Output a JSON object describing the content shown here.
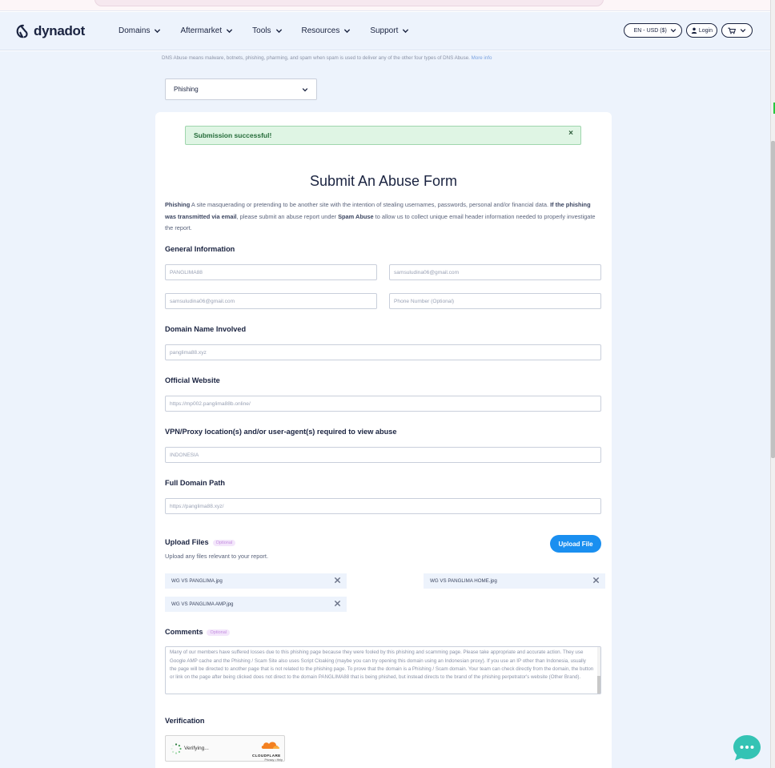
{
  "header": {
    "brand": "dynadot",
    "nav": [
      {
        "label": "Domains"
      },
      {
        "label": "Aftermarket"
      },
      {
        "label": "Tools"
      },
      {
        "label": "Resources"
      },
      {
        "label": "Support"
      }
    ],
    "locale_label": "EN - USD ($)",
    "login_label": "Login"
  },
  "dns_note": {
    "text": "DNS Abuse means malware, botnets, phishing, pharming, and spam when spam is used to deliver any of the other four types of DNS Abuse.",
    "more_link": "More info"
  },
  "abuse_type": {
    "selected": "Phishing"
  },
  "alert": {
    "message": "Submission successful!",
    "close": "×"
  },
  "form": {
    "title": "Submit An Abuse Form",
    "desc": {
      "term": "Phishing",
      "part1": " A site masquerading or pretending to be another site with the intention of stealing usernames, passwords, personal and/or financial data. ",
      "bold2": "If the phishing was transmitted via email",
      "part2": ", please submit an abuse report under ",
      "bold3": "Spam Abuse",
      "part3": " to allow us to collect unique email header information needed to properly investigate the report."
    },
    "general_info": {
      "heading": "General Information",
      "name_value": "PANGLIMA88",
      "email_value": "samsuludina06@gmail.com",
      "confirm_email_value": "samsuludina06@gmail.com",
      "phone_placeholder": "Phone Number (Optional)"
    },
    "domain_involved": {
      "heading": "Domain Name Involved",
      "value": "panglima88.xyz"
    },
    "official_website": {
      "heading": "Official Website",
      "value": "https://mp002.panglima88b.online/"
    },
    "vpn": {
      "heading": "VPN/Proxy location(s) and/or user-agent(s) required to view abuse",
      "value": "INDONESIA"
    },
    "full_path": {
      "heading": "Full Domain Path",
      "value": "https://panglima88.xyz/"
    },
    "upload": {
      "heading": "Upload Files",
      "optional": "Optional",
      "sub": "Upload any files relevant to your report.",
      "button": "Upload File",
      "files": [
        "WG VS PANGLIMA.jpg",
        "WG VS PANGLIMA HOME.jpg",
        "WG VS PANGLIMA AMP.jpg"
      ]
    },
    "comments": {
      "heading": "Comments",
      "optional": "Optional",
      "value": "brand. This is definitely very dangerous. Must be investigated. It turned out that they bought the domain through your registrar. We have also tried to report this domain to the hosting provider. Many of our members have suffered losses due to this phishing page because they were fooled by this phishing and scamming page. Please take appropriate and accurate action. They use Google AMP cache and the Phishing / Scam Site also uses Script Cloaking (maybe you can try opening this domain using an Indonesian proxy). If you use an IP other than Indonesia, usually the page will be directed to another page that is not related to the phishing page. To prove that the domain is a Phishing / Scam domain. Your team can check directly from the domain, the button or link on the page after being clicked does not direct to the domain PANGLIMA88 that is being phished, but instead directs to the brand of the phishing perpetrator's website (Other Brand)."
    },
    "verification": {
      "heading": "Verification",
      "status": "Verifying...",
      "provider": "CLOUDFLARE",
      "privacy": "Privacy",
      "sep": " • ",
      "help": "Help"
    }
  },
  "colors": {
    "page_bg": "#edf3fc",
    "accent_blue": "#1a8ff0",
    "success_bg": "#dff5e4",
    "success_text": "#256c3a",
    "chat_teal": "#34c3b4"
  }
}
